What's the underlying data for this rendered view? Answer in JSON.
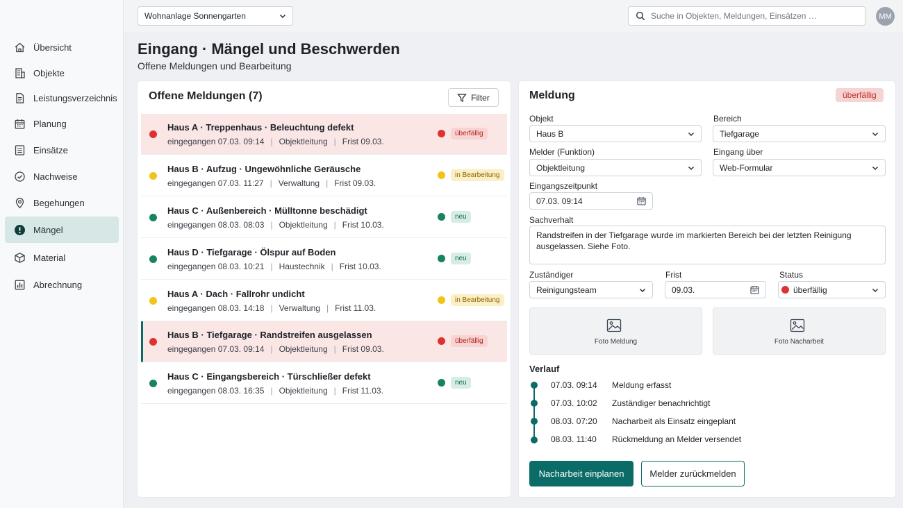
{
  "header": {
    "property_select": "Wohnanlage Sonnengarten",
    "search_placeholder": "Suche in Objekten, Meldungen, Einsätzen …",
    "avatar_initials": "MM"
  },
  "sidebar": {
    "items": [
      {
        "label": "Übersicht",
        "icon": "home-icon"
      },
      {
        "label": "Objekte",
        "icon": "building-icon"
      },
      {
        "label": "Leistungsverzeichnis",
        "icon": "document-icon"
      },
      {
        "label": "Planung",
        "icon": "calendar-icon"
      },
      {
        "label": "Einsätze",
        "icon": "list-icon"
      },
      {
        "label": "Nachweise",
        "icon": "check-circle-icon"
      },
      {
        "label": "Begehungen",
        "icon": "map-pin-icon"
      },
      {
        "label": "Mängel",
        "icon": "alert-icon",
        "active": true
      },
      {
        "label": "Material",
        "icon": "box-icon"
      },
      {
        "label": "Abrechnung",
        "icon": "bar-chart-icon"
      }
    ]
  },
  "page": {
    "title": "Eingang · Mängel und Beschwerden",
    "subtitle": "Offene Meldungen und Bearbeitung"
  },
  "list": {
    "title": "Offene Meldungen (7)",
    "filter_label": "Filter",
    "rows": [
      {
        "title": "Haus A · Treppenhaus · Beleuchtung defekt",
        "received": "eingegangen 07.03. 09:14",
        "role": "Objektleitung",
        "due": "Frist 09.03.",
        "status": "überfällig"
      },
      {
        "title": "Haus B · Aufzug · Ungewöhnliche Geräusche",
        "received": "eingegangen 07.03. 11:27",
        "role": "Verwaltung",
        "due": "Frist 09.03.",
        "status": "in Bearbeitung"
      },
      {
        "title": "Haus C · Außenbereich · Mülltonne beschädigt",
        "received": "eingegangen 08.03. 08:03",
        "role": "Objektleitung",
        "due": "Frist 10.03.",
        "status": "neu"
      },
      {
        "title": "Haus D · Tiefgarage · Ölspur auf Boden",
        "received": "eingegangen 08.03. 10:21",
        "role": "Haustechnik",
        "due": "Frist 10.03.",
        "status": "neu"
      },
      {
        "title": "Haus A · Dach · Fallrohr undicht",
        "received": "eingegangen 08.03. 14:18",
        "role": "Verwaltung",
        "due": "Frist 11.03.",
        "status": "in Bearbeitung"
      },
      {
        "title": "Haus B · Tiefgarage · Randstreifen ausgelassen",
        "received": "eingegangen 07.03. 09:14",
        "role": "Objektleitung",
        "due": "Frist 09.03.",
        "status": "überfällig"
      },
      {
        "title": "Haus C · Eingangsbereich · Türschließer defekt",
        "received": "eingegangen 08.03. 16:35",
        "role": "Objektleitung",
        "due": "Frist 11.03.",
        "status": "neu"
      }
    ]
  },
  "detail": {
    "title": "Meldung",
    "status_badge": "überfällig",
    "objekt_label": "Objekt",
    "objekt_value": "Haus B",
    "bereich_label": "Bereich",
    "bereich_value": "Tiefgarage",
    "melder_label": "Melder (Funktion)",
    "melder_value": "Objektleitung",
    "eingang_label": "Eingang über",
    "eingang_value": "Web-Formular",
    "zeitpunkt_label": "Eingangszeitpunkt",
    "zeitpunkt_value": "07.03. 09:14",
    "sachverhalt_label": "Sachverhalt",
    "sachverhalt_value": "Randstreifen in der Tiefgarage wurde im markierten Bereich bei der letzten Reinigung ausgelassen. Siehe Foto.",
    "zustaendig_label": "Zuständiger",
    "zustaendig_value": "Reinigungsteam",
    "frist_label": "Frist",
    "frist_value": "09.03.",
    "status_label": "Status",
    "status_value": "überfällig",
    "photo1_label": "Foto Meldung",
    "photo2_label": "Foto Nacharbeit",
    "verlauf_label": "Verlauf",
    "timeline": [
      {
        "time": "07.03. 09:14",
        "text": "Meldung erfasst"
      },
      {
        "time": "07.03. 10:02",
        "text": "Zuständiger benachrichtigt"
      },
      {
        "time": "08.03. 07:20",
        "text": "Nacharbeit als Einsatz eingeplant"
      },
      {
        "time": "08.03. 11:40",
        "text": "Rückmeldung an Melder versendet"
      }
    ],
    "primary_button": "Nacharbeit einplanen",
    "secondary_button": "Melder zurückmelden"
  },
  "colors": {
    "accent": "#0b6b66",
    "red": "#e03131",
    "yellow": "#f0c419",
    "green": "#17855a"
  }
}
